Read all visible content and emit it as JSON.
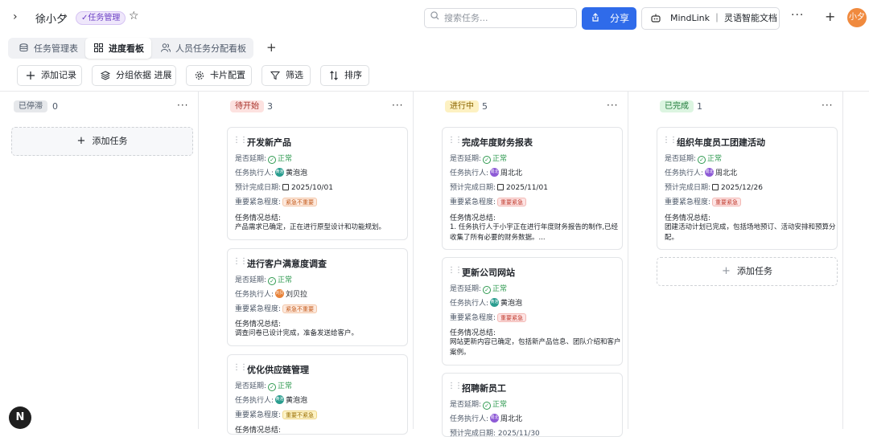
{
  "header": {
    "user": "徐小夕",
    "tag": "✓任务管理",
    "search_placeholder": "搜索任务...",
    "share_label": "分享",
    "mindlink_label": "MindLink ｜ 灵语智能文档",
    "avatar_text": "小夕",
    "more": "···",
    "plus": "+"
  },
  "tabs": [
    {
      "label": "任务管理表"
    },
    {
      "label": "进度看板"
    },
    {
      "label": "人员任务分配看板"
    }
  ],
  "toolbar": {
    "add_record": "添加记录",
    "group_by": "分组依据 进展",
    "card_config": "卡片配置",
    "filter": "筛选",
    "sort": "排序"
  },
  "labels": {
    "delay": "是否延期:",
    "executor": "任务执行人:",
    "due": "预计完成日期:",
    "priority": "重要紧急程度:",
    "summary": "任务情况总结:",
    "add_task": "添加任务",
    "normal": "正常"
  },
  "columns": [
    {
      "status": "已停滞",
      "count": "0",
      "color": "#e6e8eb",
      "text_color": "#4e5969"
    },
    {
      "status": "待开始",
      "count": "3",
      "color": "#fde2e0",
      "text_color": "#a8332b"
    },
    {
      "status": "进行中",
      "count": "5",
      "color": "#fdf1c2",
      "text_color": "#8a6400"
    },
    {
      "status": "已完成",
      "count": "1",
      "color": "#dcf5e1",
      "text_color": "#1f7a39"
    }
  ],
  "cards": {
    "c1": {
      "title": "开发新产品",
      "executor": "黄泡泡",
      "due": "2025/10/01",
      "priority": "紧急不重要",
      "summary": "产品需求已确定，正在进行原型设计和功能规划。"
    },
    "c2": {
      "title": "进行客户满意度调查",
      "executor": "刘贝拉",
      "priority": "紧急不重要",
      "summary": "调查问卷已设计完成，准备发送给客户。"
    },
    "c3": {
      "title": "优化供应链管理",
      "executor": "黄泡泡",
      "priority": "重要不紧急",
      "summary": "任务情况总结:"
    },
    "c4": {
      "title": "完成年度财务报表",
      "executor": "周北北",
      "due": "2025/11/01",
      "priority": "重要紧急",
      "summary": "1. 任务执行人于小宇正在进行年度财务报告的制作,已经收集了所有必要的财务数据。..."
    },
    "c5": {
      "title": "更新公司网站",
      "executor": "黄泡泡",
      "priority": "重要紧急",
      "summary": "网站更新内容已确定，包括新产品信息、团队介绍和客户案例。"
    },
    "c6": {
      "title": "招聘新员工",
      "executor": "周北北",
      "due": "预计完成日期: 2025/11/30"
    },
    "c7": {
      "title": "组织年度员工团建活动",
      "executor": "周北北",
      "due": "2025/12/26",
      "priority": "重要紧急",
      "summary": "团建活动计划已完成，包括场地预订、活动安排和预算分配。"
    }
  },
  "avatars": {
    "huang": "黄泡",
    "liu": "刘贝",
    "zhou": "周北"
  },
  "badge": "N"
}
